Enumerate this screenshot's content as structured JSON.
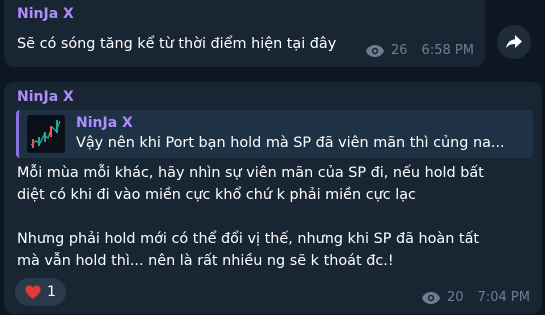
{
  "messages": [
    {
      "sender": "NinJa X",
      "text": "Sẽ có sóng tăng kể từ thời điểm hiện tại đây",
      "views": "26",
      "time": "6:58 PM"
    },
    {
      "sender": "NinJa X",
      "reply": {
        "sender": "NinJa X",
        "text": "Vậy nên khi Port bạn hold mà SP đã viên mãn thì củng na..."
      },
      "lines": [
        "Mỗi mùa mỗi khác, hãy nhìn sự viên mãn của SP đi, nếu hold bất",
        "diệt có khi đi vào miền cực khổ chứ k phải miền cực lạc",
        "",
        "Nhưng phải hold mới có thể đổi vị thế, nhưng khi SP đã hoàn tất",
        "mà vẫn hold thì... nên là rất nhiều ng sẽ k thoát đc.!"
      ],
      "reaction": {
        "emoji": "heart-icon",
        "count": "1"
      },
      "views": "20",
      "time": "7:04 PM"
    }
  ],
  "colors": {
    "background": "#0e1621",
    "bubble": "#182533",
    "sender": "#b18cff",
    "meta": "#6d7f8f",
    "reply_bar": "#8774e1",
    "heart": "#e53935"
  }
}
